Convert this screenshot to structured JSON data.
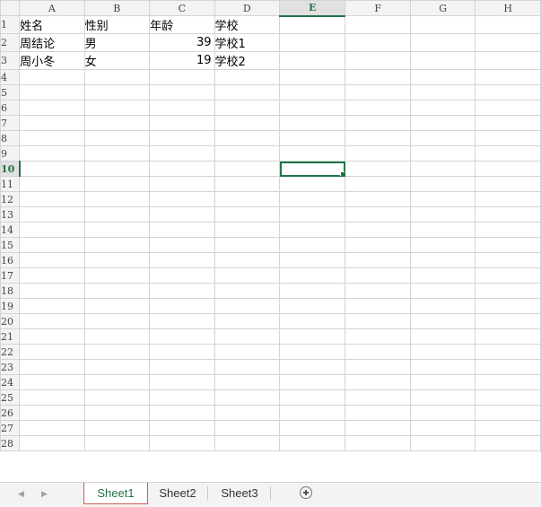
{
  "columns": [
    "A",
    "B",
    "C",
    "D",
    "E",
    "F",
    "G",
    "H"
  ],
  "active_column": "E",
  "active_row": 10,
  "row_count": 28,
  "cells": {
    "1": {
      "A": "姓名",
      "B": "性别",
      "C": "年龄",
      "D": "学校"
    },
    "2": {
      "A": "周结论",
      "B": "男",
      "C": "39",
      "D": "学校1"
    },
    "3": {
      "A": "周小冬",
      "B": "女",
      "C": "19",
      "D": "学校2"
    }
  },
  "numeric_columns": [
    "C"
  ],
  "sheet_tabs": [
    {
      "label": "Sheet1",
      "active": true
    },
    {
      "label": "Sheet2",
      "active": false
    },
    {
      "label": "Sheet3",
      "active": false
    }
  ],
  "nav": {
    "prev_icon": "left-arrow-icon",
    "next_icon": "right-arrow-icon",
    "add_icon": "plus-circle-icon"
  },
  "colors": {
    "accent": "#217346",
    "active_tab_border": "#d35a4e",
    "header_bg": "#f3f3f3",
    "gridline": "#d4d4d4"
  }
}
